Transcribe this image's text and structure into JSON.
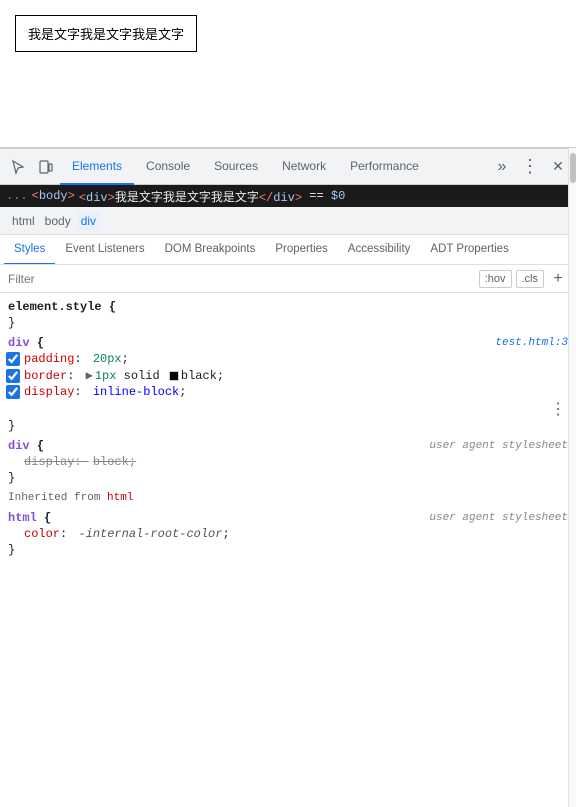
{
  "viewport": {
    "demo_text": "我是文字我是文字我是文字"
  },
  "devtools": {
    "toolbar": {
      "inspect_icon": "⬚",
      "device_icon": "📱",
      "tabs": [
        {
          "label": "Elements",
          "active": true
        },
        {
          "label": "Console",
          "active": false
        },
        {
          "label": "Sources",
          "active": false
        },
        {
          "label": "Network",
          "active": false
        },
        {
          "label": "Performance",
          "active": false
        }
      ],
      "more_icon": "»",
      "settings_icon": "⋮",
      "close_icon": "✕"
    },
    "dom_line": {
      "ellipsis": "...",
      "tag_open": "<body>",
      "indent": "  ",
      "div_open": "<div>",
      "text_content": "我是文字我是文字我是文字",
      "div_close": "</div>",
      "eq": " == ",
      "dollar": "$0"
    },
    "breadcrumb": {
      "items": [
        {
          "label": "html",
          "active": false
        },
        {
          "label": "body",
          "active": false
        },
        {
          "label": "div",
          "active": true
        }
      ]
    },
    "styles_tabs": [
      {
        "label": "Styles",
        "active": true
      },
      {
        "label": "Event Listeners",
        "active": false
      },
      {
        "label": "DOM Breakpoints",
        "active": false
      },
      {
        "label": "Properties",
        "active": false
      },
      {
        "label": "Accessibility",
        "active": false
      },
      {
        "label": "ADT Properties",
        "active": false
      }
    ],
    "filter": {
      "placeholder": "Filter",
      "hov_label": ":hov",
      "cls_label": ".cls",
      "add_icon": "+"
    },
    "rules": [
      {
        "id": "element_style",
        "selector": "element.style",
        "origin": null,
        "properties": [],
        "close": true
      },
      {
        "id": "div_rule",
        "selector": "div",
        "origin": "test.html:3",
        "properties": [
          {
            "checked": true,
            "name": "padding",
            "value": "20px",
            "type": "normal"
          },
          {
            "checked": true,
            "name": "border",
            "value": "1px solid",
            "color_swatch": true,
            "color": "#000000",
            "extra": "black",
            "type": "color"
          },
          {
            "checked": true,
            "name": "display",
            "value": "inline-block",
            "type": "keyword"
          }
        ],
        "has_more": true,
        "close": true
      },
      {
        "id": "div_agent",
        "selector": "div",
        "origin": "user agent stylesheet",
        "properties": [
          {
            "checked": false,
            "name": "display",
            "value": "block",
            "type": "strikethrough"
          }
        ],
        "close": true
      },
      {
        "id": "inherited",
        "is_inherited": true,
        "from_tag": "html"
      },
      {
        "id": "html_rule",
        "selector": "html",
        "origin": "user agent stylesheet",
        "properties": [
          {
            "checked": false,
            "name": "color",
            "value": "-internal-root-color",
            "type": "italic"
          }
        ],
        "close": true
      }
    ]
  }
}
